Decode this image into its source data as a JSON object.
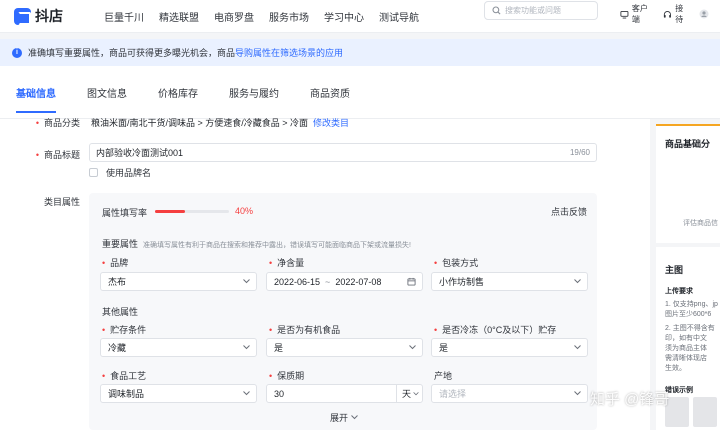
{
  "app": {
    "name": "抖店"
  },
  "topnav": [
    "巨量千川",
    "精选联盟",
    "电商罗盘",
    "服务市场",
    "学习中心",
    "测试导航"
  ],
  "search": {
    "placeholder": "搜索功能或问题"
  },
  "top_right": {
    "client": "客户端",
    "reception": "接待"
  },
  "notice": {
    "text": "准确填写重要属性，商品可获得更多曝光机会，商品",
    "link": "导购属性在筛选场景的应用"
  },
  "tabs": [
    "基础信息",
    "图文信息",
    "价格库存",
    "服务与履约",
    "商品资质"
  ],
  "active_tab": "基础信息",
  "category": {
    "label": "商品分类",
    "value": "粮油米面/南北干货/调味品 > 方便速食/冷藏食品 > 冷面",
    "edit": "修改类目"
  },
  "title": {
    "label": "商品标题",
    "value": "内部验收冷面测试001",
    "count": "19/60",
    "use_brand": "使用品牌名"
  },
  "attributes": {
    "label": "类目属性",
    "fill_rate_label": "属性填写率",
    "fill_rate": 0.4,
    "fill_rate_text": "40%",
    "feedback": "点击反馈",
    "important_title": "重要属性",
    "important_hint": "准确填写属性有利于商品在搜索和推荐中露出，错误填写可能面临商品下架或流量损失!",
    "brand": {
      "label": "品牌",
      "value": "杰布"
    },
    "net_content": {
      "label": "净含量",
      "start": "2022-06-15",
      "sep": "~",
      "end": "2022-07-08"
    },
    "packaging": {
      "label": "包装方式",
      "value": "小作坊制售"
    },
    "other_title": "其他属性",
    "storage": {
      "label": "贮存条件",
      "value": "冷藏"
    },
    "organic": {
      "label": "是否为有机食品",
      "value": "是"
    },
    "frozen": {
      "label": "是否冷冻（0°C及以下）贮存",
      "value": "是"
    },
    "process": {
      "label": "食品工艺",
      "value": "调味制品"
    },
    "shelf_life": {
      "label": "保质期",
      "value": "30",
      "unit": "天"
    },
    "origin": {
      "label": "产地",
      "placeholder": "请选择"
    },
    "expand": "展开"
  },
  "right_panel": {
    "score_title": "商品基础分",
    "evaluation": "评估商品信",
    "main_title": "主图",
    "upload_req": "上传要求",
    "items": [
      "1. 仅支持png、jp",
      "图片至少600*6",
      "2. 主图不得含有",
      "印，如有中文",
      "须为商品主体",
      "需清晰体现店",
      "生效。"
    ],
    "error_example": "错误示例"
  },
  "watermark": "知乎 @锋哥"
}
